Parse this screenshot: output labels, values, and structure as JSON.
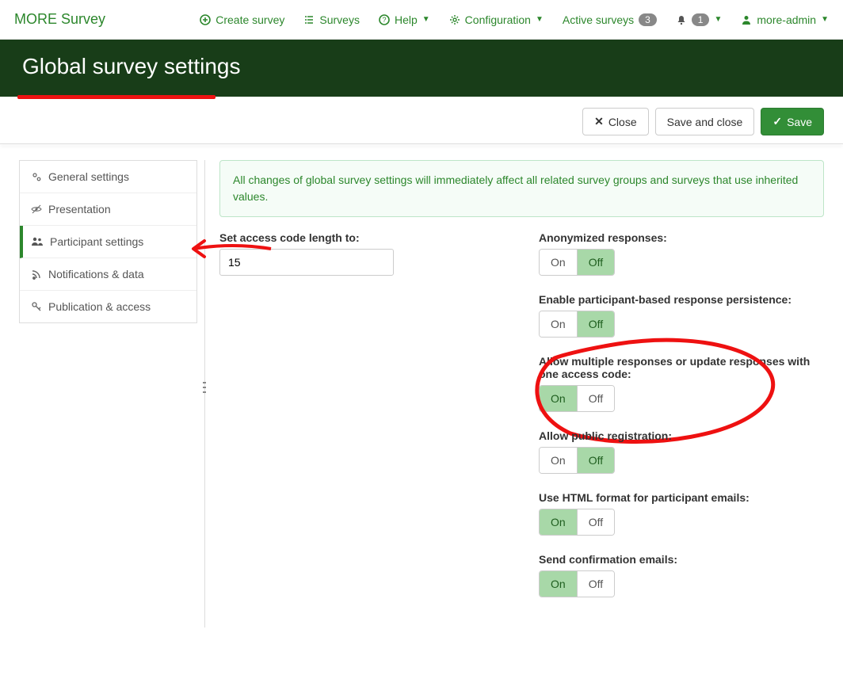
{
  "brand": "MORE Survey",
  "nav": {
    "create": "Create survey",
    "surveys": "Surveys",
    "help": "Help",
    "config": "Configuration",
    "active": "Active surveys",
    "active_count": "3",
    "notif_count": "1",
    "user": "more-admin"
  },
  "page_title": "Global survey settings",
  "toolbar": {
    "close": "Close",
    "save_close": "Save and close",
    "save": "Save"
  },
  "sidebar": {
    "items": [
      {
        "label": "General settings"
      },
      {
        "label": "Presentation"
      },
      {
        "label": "Participant settings"
      },
      {
        "label": "Notifications & data"
      },
      {
        "label": "Publication & access"
      }
    ]
  },
  "alert": "All changes of global survey settings will immediately affect all related survey groups and surveys that use inherited values.",
  "left": {
    "access_code_label": "Set access code length to:",
    "access_code_value": "15"
  },
  "toggle_labels": {
    "on": "On",
    "off": "Off"
  },
  "right": {
    "anon": {
      "label": "Anonymized responses:",
      "value": "off"
    },
    "persist": {
      "label": "Enable participant-based response persistence:",
      "value": "off"
    },
    "multi": {
      "label": "Allow multiple responses or update responses with one access code:",
      "value": "on"
    },
    "pubreg": {
      "label": "Allow public registration:",
      "value": "off"
    },
    "htmlmail": {
      "label": "Use HTML format for participant emails:",
      "value": "on"
    },
    "confirm": {
      "label": "Send confirmation emails:",
      "value": "on"
    }
  }
}
